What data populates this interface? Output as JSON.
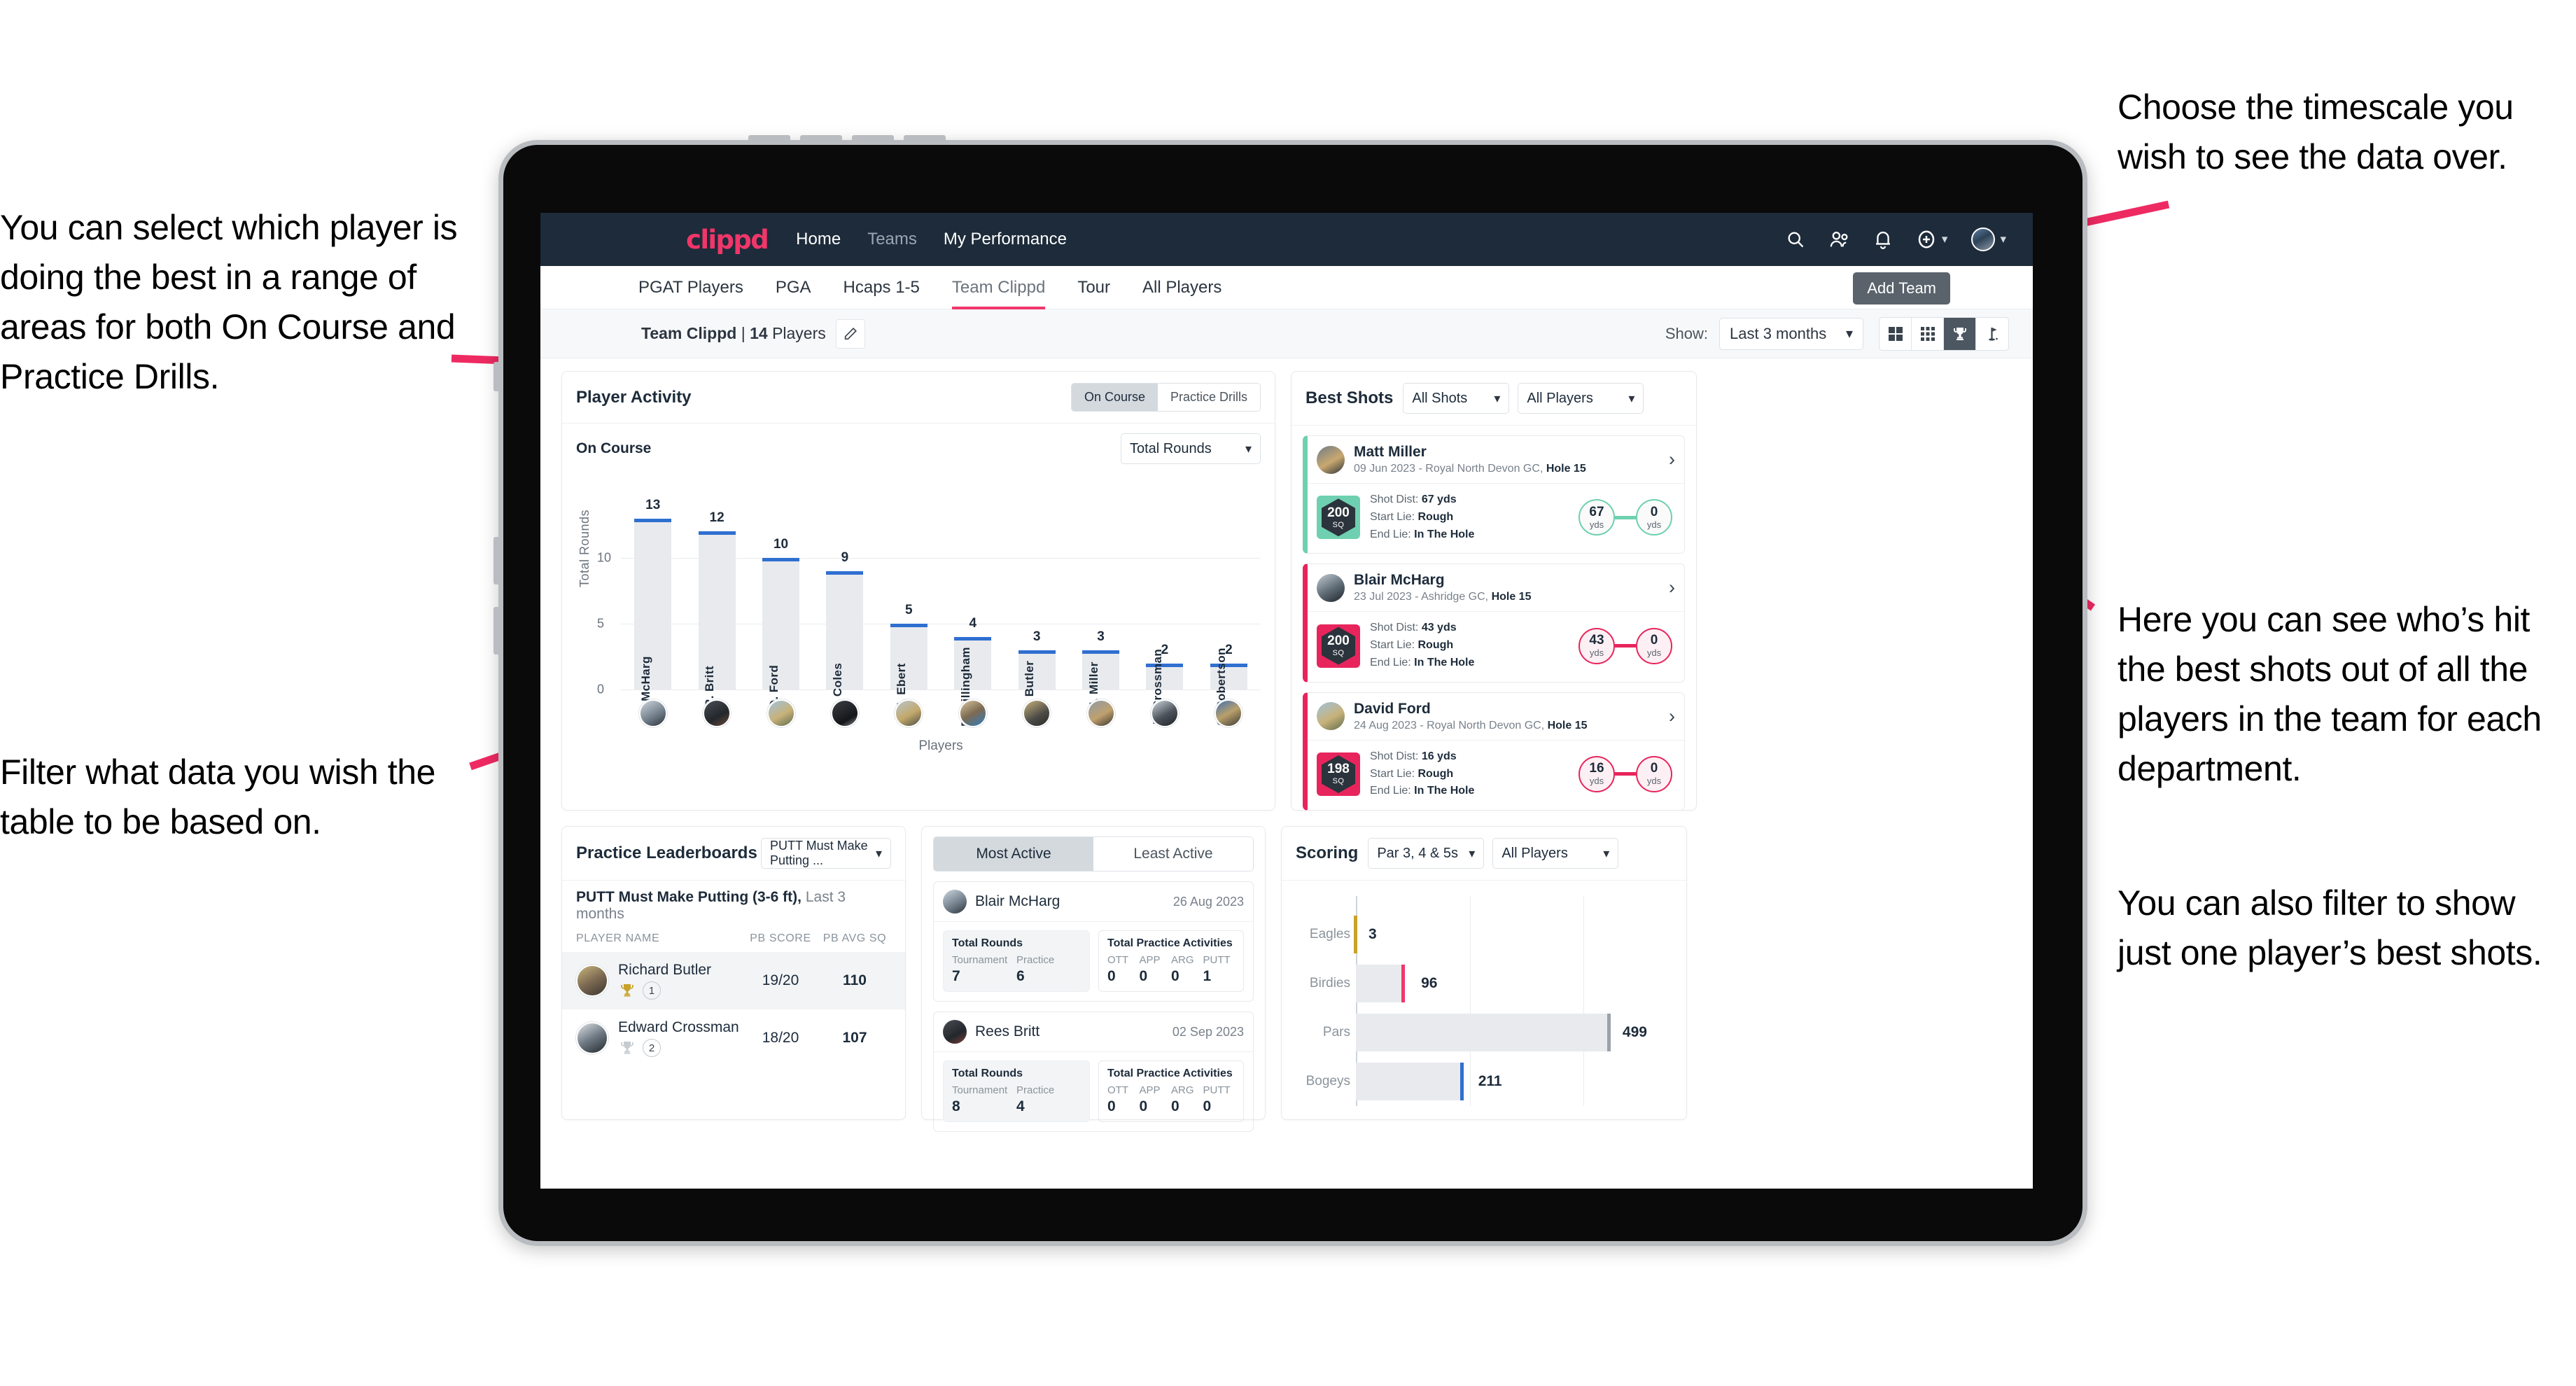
{
  "annotations": {
    "left_top": "You can select which player is doing the best in a range of areas for both On Course and Practice Drills.",
    "left_bottom": "Filter what data you wish the table to be based on.",
    "right_top": "Choose the timescale you wish to see the data over.",
    "right_middle": "Here you can see who’s hit the best shots out of all the players in the team for each department.",
    "right_bottom": "You can also filter to show just one player’s best shots."
  },
  "topnav": {
    "brand": "clippd",
    "links": [
      "Home",
      "Teams",
      "My Performance"
    ],
    "icons": [
      "search-icon",
      "people-icon",
      "bell-icon",
      "plus-circle-icon",
      "avatar"
    ]
  },
  "tabs": {
    "items": [
      "PGAT Players",
      "PGA",
      "Hcaps 1-5",
      "Team Clippd",
      "Tour",
      "All Players"
    ],
    "active": "Team Clippd",
    "tooltip": "Add Team"
  },
  "subheader": {
    "team_name": "Team Clippd",
    "team_count": "14",
    "team_suffix": "Players",
    "show_label": "Show:",
    "timescale": "Last 3 months",
    "view_icons": [
      "grid-large-icon",
      "grid-small-icon",
      "trophy-icon",
      "flag-icon"
    ],
    "active_view": "trophy-icon"
  },
  "player_activity": {
    "title": "Player Activity",
    "segments": [
      "On Course",
      "Practice Drills"
    ],
    "active_segment": "On Course",
    "sub_label": "On Course",
    "metric_select": "Total Rounds"
  },
  "chart_data": [
    {
      "type": "bar",
      "title": "Player Activity — On Course",
      "xlabel": "Players",
      "ylabel": "Total Rounds",
      "ylim": [
        0,
        15
      ],
      "yticks": [
        0,
        5,
        10
      ],
      "grid": true,
      "categories": [
        "B. McHarg",
        "R. Britt",
        "D. Ford",
        "J. Coles",
        "E. Ebert",
        "D. Billingham",
        "R. Butler",
        "M. Miller",
        "E. Crossman",
        "C. Robertson"
      ],
      "values": [
        13,
        12,
        10,
        9,
        5,
        4,
        3,
        3,
        2,
        2
      ]
    },
    {
      "type": "bar",
      "orientation": "horizontal",
      "title": "Scoring",
      "categories": [
        "Eagles",
        "Birdies",
        "Pars",
        "Bogeys"
      ],
      "values": [
        3,
        96,
        499,
        211
      ],
      "xlim": [
        0,
        620
      ],
      "grid": true
    }
  ],
  "best_shots": {
    "title": "Best Shots",
    "shot_filter": "All Shots",
    "player_filter": "All Players",
    "items": [
      {
        "name": "Matt Miller",
        "meta_date": "09 Jun 2023 - Royal North Devon GC, ",
        "meta_hole": "Hole 15",
        "sq": "200",
        "sq_unit": "SQ",
        "accent": "#6ed0b0",
        "shot_dist_label": "Shot Dist: ",
        "shot_dist": "67 yds",
        "start_lie_label": "Start Lie: ",
        "start_lie": "Rough",
        "end_lie_label": "End Lie: ",
        "end_lie": "In The Hole",
        "from_val": "67",
        "from_unit": "yds",
        "to_val": "0",
        "to_unit": "yds"
      },
      {
        "name": "Blair McHarg",
        "meta_date": "23 Jul 2023 - Ashridge GC, ",
        "meta_hole": "Hole 15",
        "sq": "200",
        "sq_unit": "SQ",
        "accent": "#e8245c",
        "shot_dist_label": "Shot Dist: ",
        "shot_dist": "43 yds",
        "start_lie_label": "Start Lie: ",
        "start_lie": "Rough",
        "end_lie_label": "End Lie: ",
        "end_lie": "In The Hole",
        "from_val": "43",
        "from_unit": "yds",
        "to_val": "0",
        "to_unit": "yds"
      },
      {
        "name": "David Ford",
        "meta_date": "24 Aug 2023 - Royal North Devon GC, ",
        "meta_hole": "Hole 15",
        "sq": "198",
        "sq_unit": "SQ",
        "accent": "#e8245c",
        "shot_dist_label": "Shot Dist: ",
        "shot_dist": "16 yds",
        "start_lie_label": "Start Lie: ",
        "start_lie": "Rough",
        "end_lie_label": "End Lie: ",
        "end_lie": "In The Hole",
        "from_val": "16",
        "from_unit": "yds",
        "to_val": "0",
        "to_unit": "yds"
      }
    ]
  },
  "practice_leaderboards": {
    "title": "Practice Leaderboards",
    "drill_select": "PUTT Must Make Putting ...",
    "subtitle_bold": "PUTT Must Make Putting (3-6 ft),",
    "subtitle_rest": " Last 3 months",
    "columns": [
      "PLAYER NAME",
      "PB SCORE",
      "PB AVG SQ"
    ],
    "rows": [
      {
        "name": "Richard Butler",
        "rank": "1",
        "trophy": "gold",
        "pb_score": "19/20",
        "pb_avg_sq": "110"
      },
      {
        "name": "Edward Crossman",
        "rank": "2",
        "trophy": "silver",
        "pb_score": "18/20",
        "pb_avg_sq": "107"
      }
    ]
  },
  "activity": {
    "tabs": [
      "Most Active",
      "Least Active"
    ],
    "active_tab": "Most Active",
    "rounds_title": "Total Rounds",
    "rounds_keys": [
      "Tournament",
      "Practice"
    ],
    "practice_title": "Total Practice Activities",
    "practice_keys": [
      "OTT",
      "APP",
      "ARG",
      "PUTT"
    ],
    "items": [
      {
        "name": "Blair McHarg",
        "date": "26 Aug 2023",
        "rounds": [
          "7",
          "6"
        ],
        "practice": [
          "0",
          "0",
          "0",
          "1"
        ]
      },
      {
        "name": "Rees Britt",
        "date": "02 Sep 2023",
        "rounds": [
          "8",
          "4"
        ],
        "practice": [
          "0",
          "0",
          "0",
          "0"
        ]
      }
    ]
  },
  "scoring": {
    "title": "Scoring",
    "par_select": "Par 3, 4 & 5s",
    "player_select": "All Players"
  },
  "colors": {
    "brand_pink": "#f0366a",
    "nav_dark": "#1d2b3a",
    "bar_blue": "#2f6fd0",
    "teal": "#6ed0b0",
    "gold": "#c9a227"
  }
}
